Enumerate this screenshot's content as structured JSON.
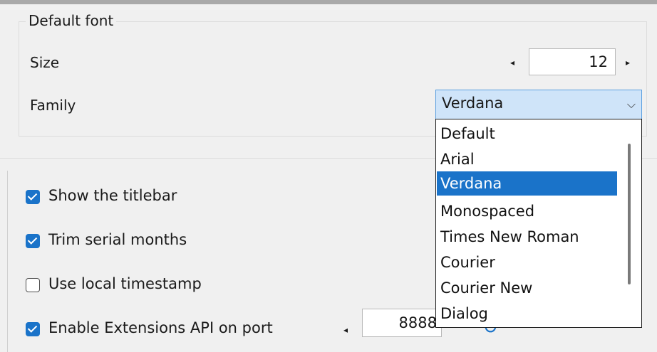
{
  "default_font": {
    "legend": "Default font",
    "size_label": "Size",
    "size_value": "12",
    "family_label": "Family",
    "family_selected": "Verdana",
    "family_options": [
      "Default",
      "Arial",
      "Verdana",
      "Monospaced",
      "Times New Roman",
      "Courier",
      "Courier New",
      "Dialog"
    ]
  },
  "options": {
    "show_titlebar": {
      "label": "Show the titlebar",
      "checked": true
    },
    "trim_serial_months": {
      "label": "Trim serial months",
      "checked": true
    },
    "use_local_timestamp": {
      "label": "Use local timestamp",
      "checked": false
    },
    "enable_extensions_api": {
      "label": "Enable Extensions API on port",
      "checked": true,
      "port": "8888"
    }
  },
  "icons": {
    "left_arrow": "◂",
    "right_arrow": "▸",
    "chevron_down": "⌵",
    "reset": "↻"
  },
  "colors": {
    "accent": "#1a73c9",
    "combo_bg": "#cfe4f9"
  }
}
